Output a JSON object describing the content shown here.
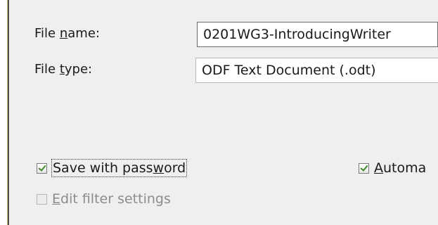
{
  "file_name": {
    "label_pre": "File ",
    "label_key": "n",
    "label_post": "ame:",
    "value": "0201WG3-IntroducingWriter"
  },
  "file_type": {
    "label_pre": "File ",
    "label_key": "t",
    "label_post": "ype:",
    "value": "ODF Text Document (.odt)"
  },
  "options": {
    "save_with_password": {
      "label_pre": "Save with pass",
      "label_key": "w",
      "label_post": "ord",
      "checked": true
    },
    "automatic_extension": {
      "label_pre": "",
      "label_key": "A",
      "label_post": "utoma",
      "checked": true
    },
    "edit_filter_settings": {
      "label_pre": "",
      "label_key": "E",
      "label_post": "dit filter settings",
      "checked": false,
      "disabled": true
    }
  },
  "colors": {
    "panel_background": "#efefef",
    "check_mark": "#3d8a2a",
    "disabled_text": "#8c8c8c"
  }
}
